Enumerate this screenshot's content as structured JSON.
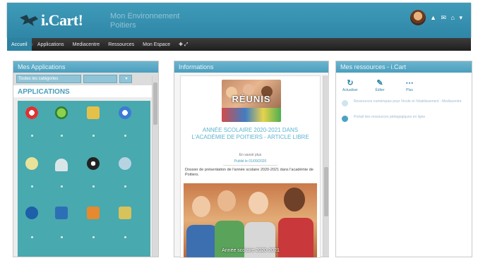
{
  "header": {
    "logo_text": "i.Cart!",
    "tagline_line1": "Mon Environnement",
    "tagline_line2": "Poitiers",
    "user_icons": "▲ ✉ ⌂ ▾"
  },
  "nav": {
    "items": [
      "Accueil",
      "Applications",
      "Mediacentre",
      "Ressources",
      "Mon Espace"
    ],
    "extra": "✚ ⤢"
  },
  "apps_panel": {
    "title": "Mes Applications",
    "select_value": "Toutes les catégories",
    "select_arrow": "▾",
    "section_label": "APPLICATIONS"
  },
  "info_panel": {
    "title": "Informations",
    "hero_word": "RÉUNIS",
    "article_title": "ANNÉE SCOLAIRE 2020-2021 DANS L'ACADÉMIE DE POITIERS - ARTICLE LIBRE",
    "byline": "En savoir plus",
    "date": "Publié le 01/09/2020",
    "body": "Dossier de présentation de l'année scolaire 2020-2021 dans l'académie de Poitiers.",
    "photo_caption": "Année scolaire 2020-2021"
  },
  "resources_panel": {
    "title": "Mes ressources - i.Cart",
    "actions": [
      {
        "icon": "↻",
        "label": "Actualiser"
      },
      {
        "icon": "✎",
        "label": "Éditer"
      },
      {
        "icon": "⋯",
        "label": "Plus"
      }
    ],
    "items": [
      "Ressources numériques pour l'école et l'établissement - Mediacentre",
      "Portail des ressources pédagogiques en ligne"
    ]
  },
  "colors": {
    "brand": "#3f9bb9",
    "navbar": "#2a2a2a",
    "apps_background": "#48a9ae"
  }
}
